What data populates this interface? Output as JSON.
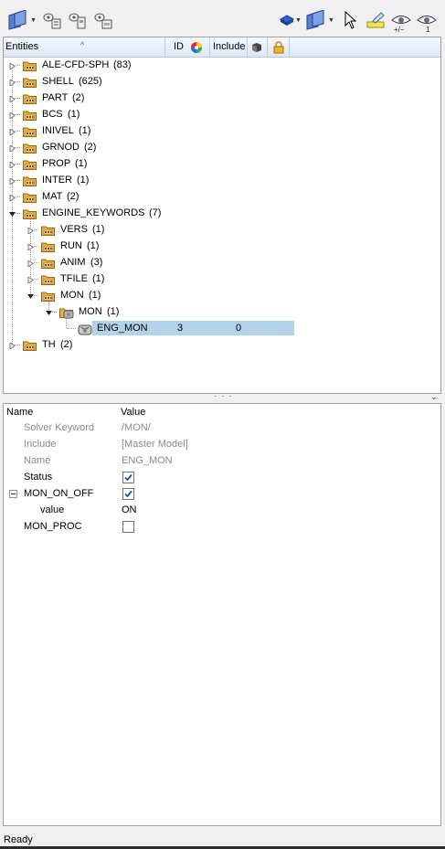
{
  "toolbar": {
    "left_tools": [
      "entity-selector-icon",
      "model-view-icon",
      "component-view-icon",
      "include-view-icon"
    ],
    "right_tools": [
      "solid-shading-icon",
      "entity-selector-icon",
      "select-pointer-icon",
      "highlight-icon",
      "show-hide-icon",
      "isolate-icon"
    ],
    "show_hide_sublabel": "+/−",
    "isolate_sublabel": "1"
  },
  "tree": {
    "columns": {
      "entities": "Entities",
      "id": "ID",
      "include": "Include"
    },
    "folders": [
      {
        "label": "ALE-CFD-SPH",
        "count": "(83)"
      },
      {
        "label": "SHELL",
        "count": "(625)"
      },
      {
        "label": "PART",
        "count": "(2)"
      },
      {
        "label": "BCS",
        "count": "(1)"
      },
      {
        "label": "INIVEL",
        "count": "(1)"
      },
      {
        "label": "GRNOD",
        "count": "(2)"
      },
      {
        "label": "PROP",
        "count": "(1)"
      },
      {
        "label": "INTER",
        "count": "(1)"
      },
      {
        "label": "MAT",
        "count": "(2)"
      },
      {
        "label": "ENGINE_KEYWORDS",
        "count": "(7)"
      }
    ],
    "engine_children": [
      {
        "label": "VERS",
        "count": "(1)"
      },
      {
        "label": "RUN",
        "count": "(1)"
      },
      {
        "label": "ANIM",
        "count": "(3)"
      },
      {
        "label": "TFILE",
        "count": "(1)"
      },
      {
        "label": "MON",
        "count": "(1)"
      }
    ],
    "mon_child": {
      "label": "MON",
      "count": "(1)"
    },
    "selected_entity": {
      "label": "ENG_MON",
      "id": "3",
      "include": "0"
    },
    "last_folder": {
      "label": "TH",
      "count": "(2)"
    }
  },
  "properties": {
    "header": {
      "name": "Name",
      "value": "Value"
    },
    "solver_keyword": {
      "name": "Solver Keyword",
      "value": "/MON/"
    },
    "include": {
      "name": "Include",
      "value": "[Master Model]"
    },
    "entity_name": {
      "name": "Name",
      "value": "ENG_MON"
    },
    "status": {
      "name": "Status",
      "checked": true
    },
    "mon_on_off": {
      "name": "MON_ON_OFF",
      "checked": true
    },
    "value_row": {
      "name": "value",
      "value": "ON"
    },
    "mon_proc": {
      "name": "MON_PROC",
      "checked": false
    }
  },
  "status_bar": {
    "text": "Ready"
  },
  "colors": {
    "selection": "#b3d3ea",
    "folder": "#e8b33c",
    "header_bg": "#dbe8f6"
  }
}
